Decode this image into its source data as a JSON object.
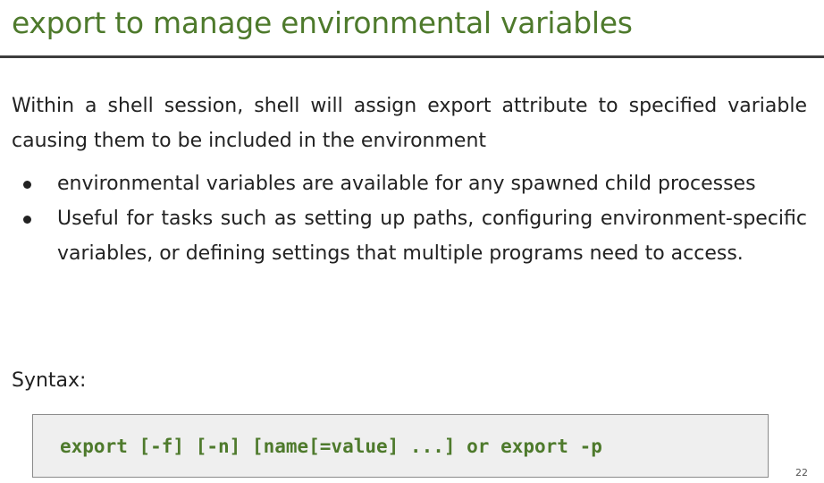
{
  "slide": {
    "title": "export to manage environmental variables",
    "intro": "Within a shell session, shell will assign export attribute to specified variable causing them to be included in the environment",
    "bullets": [
      {
        "text": "environmental variables are available for any spawned child processes"
      },
      {
        "text": "Useful for tasks such as setting up paths, configuring environment-specific variables, or defining settings that multiple programs need to access."
      }
    ],
    "syntax_label": "Syntax:",
    "code": "export [-f] [-n] [name[=value] ...] or export -p",
    "page_number": "22"
  },
  "colors": {
    "title": "#4e7a2c",
    "code_text": "#4e7a2c",
    "code_background": "#efefef",
    "rule": "#3d3d3d"
  }
}
